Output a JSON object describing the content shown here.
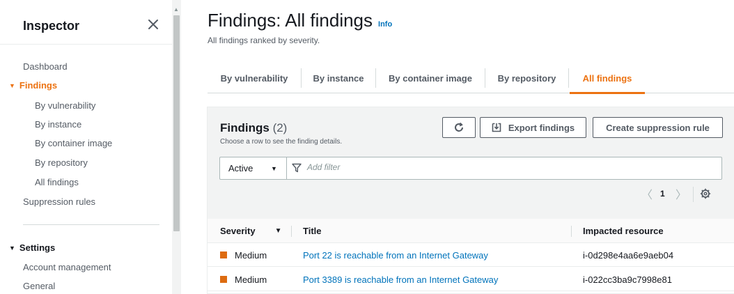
{
  "sidebar": {
    "title": "Inspector",
    "close_label": "×",
    "dashboard": "Dashboard",
    "findings": "Findings",
    "findings_items": [
      "By vulnerability",
      "By instance",
      "By container image",
      "By repository",
      "All findings"
    ],
    "suppression_rules": "Suppression rules",
    "settings": "Settings",
    "settings_items": [
      "Account management",
      "General"
    ]
  },
  "page": {
    "title": "Findings: All findings",
    "info": "Info",
    "description": "All findings ranked by severity."
  },
  "tabs": [
    {
      "label": "By vulnerability",
      "active": false
    },
    {
      "label": "By instance",
      "active": false
    },
    {
      "label": "By container image",
      "active": false
    },
    {
      "label": "By repository",
      "active": false
    },
    {
      "label": "All findings",
      "active": true
    }
  ],
  "findings_panel": {
    "title": "Findings",
    "count": "(2)",
    "description": "Choose a row to see the finding details.",
    "export_label": "Export findings",
    "suppress_label": "Create suppression rule",
    "filter_select": "Active",
    "filter_placeholder": "Add filter",
    "page_number": "1"
  },
  "table": {
    "columns": [
      "Severity",
      "Title",
      "Impacted resource"
    ],
    "rows": [
      {
        "severity": "Medium",
        "title": "Port 22 is reachable from an Internet Gateway",
        "resource": "i-0d298e4aa6e9aeb04"
      },
      {
        "severity": "Medium",
        "title": "Port 3389 is reachable from an Internet Gateway",
        "resource": "i-022cc3ba9c7998e81"
      }
    ]
  },
  "colors": {
    "accent": "#ec7211",
    "link": "#0073bb",
    "severity_medium": "#dd6b10"
  },
  "icons": {
    "close": "close-icon",
    "refresh": "refresh-icon",
    "export": "download-icon",
    "filter": "filter-icon",
    "settings": "gear-icon"
  }
}
